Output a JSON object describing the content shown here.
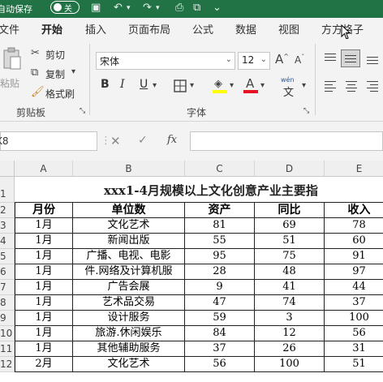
{
  "titlebar": {
    "autosave_label": "自动保存",
    "toggle_label": "关"
  },
  "tabs": [
    "文件",
    "开始",
    "插入",
    "页面布局",
    "公式",
    "数据",
    "视图",
    "方方格子"
  ],
  "ribbon": {
    "paste_label": "粘贴",
    "cut_label": "剪切",
    "copy_label": "复制",
    "format_painter_label": "格式刷",
    "clipboard_group": "剪贴板",
    "font_group": "字体",
    "font_name": "宋体",
    "font_size": "12",
    "font_color_accent": "#e81123",
    "highlight_accent": "#ffff00",
    "wen_label": "wén",
    "wen_char": "文"
  },
  "formula_bar": {
    "name_box": "K8",
    "fx": "fx",
    "content": ""
  },
  "grid": {
    "columns": [
      "A",
      "B",
      "C",
      "D",
      "E"
    ],
    "row_numbers": [
      "1",
      "2",
      "3",
      "4",
      "5",
      "6",
      "7",
      "8",
      "9",
      "10",
      "11",
      "12"
    ],
    "title": "xxx1-4月规模以上文化创意产业主要指",
    "headers": [
      "月份",
      "单位数",
      "资产",
      "同比",
      "收入"
    ],
    "rows": [
      [
        "1月",
        "文化艺术",
        "81",
        "69",
        "78"
      ],
      [
        "1月",
        "新闻出版",
        "55",
        "51",
        "60"
      ],
      [
        "1月",
        "广播、电视、电影",
        "95",
        "75",
        "91"
      ],
      [
        "1月",
        "件.网络及计算机服",
        "28",
        "48",
        "97"
      ],
      [
        "1月",
        "广告会展",
        "9",
        "41",
        "44"
      ],
      [
        "1月",
        "艺术品交易",
        "47",
        "74",
        "37"
      ],
      [
        "1月",
        "设计服务",
        "59",
        "3",
        "100"
      ],
      [
        "1月",
        "旅游.休闲娱乐",
        "84",
        "12",
        "56"
      ],
      [
        "1月",
        "其他辅助服务",
        "37",
        "26",
        "31"
      ],
      [
        "2月",
        "文化艺术",
        "56",
        "100",
        "51"
      ]
    ]
  }
}
